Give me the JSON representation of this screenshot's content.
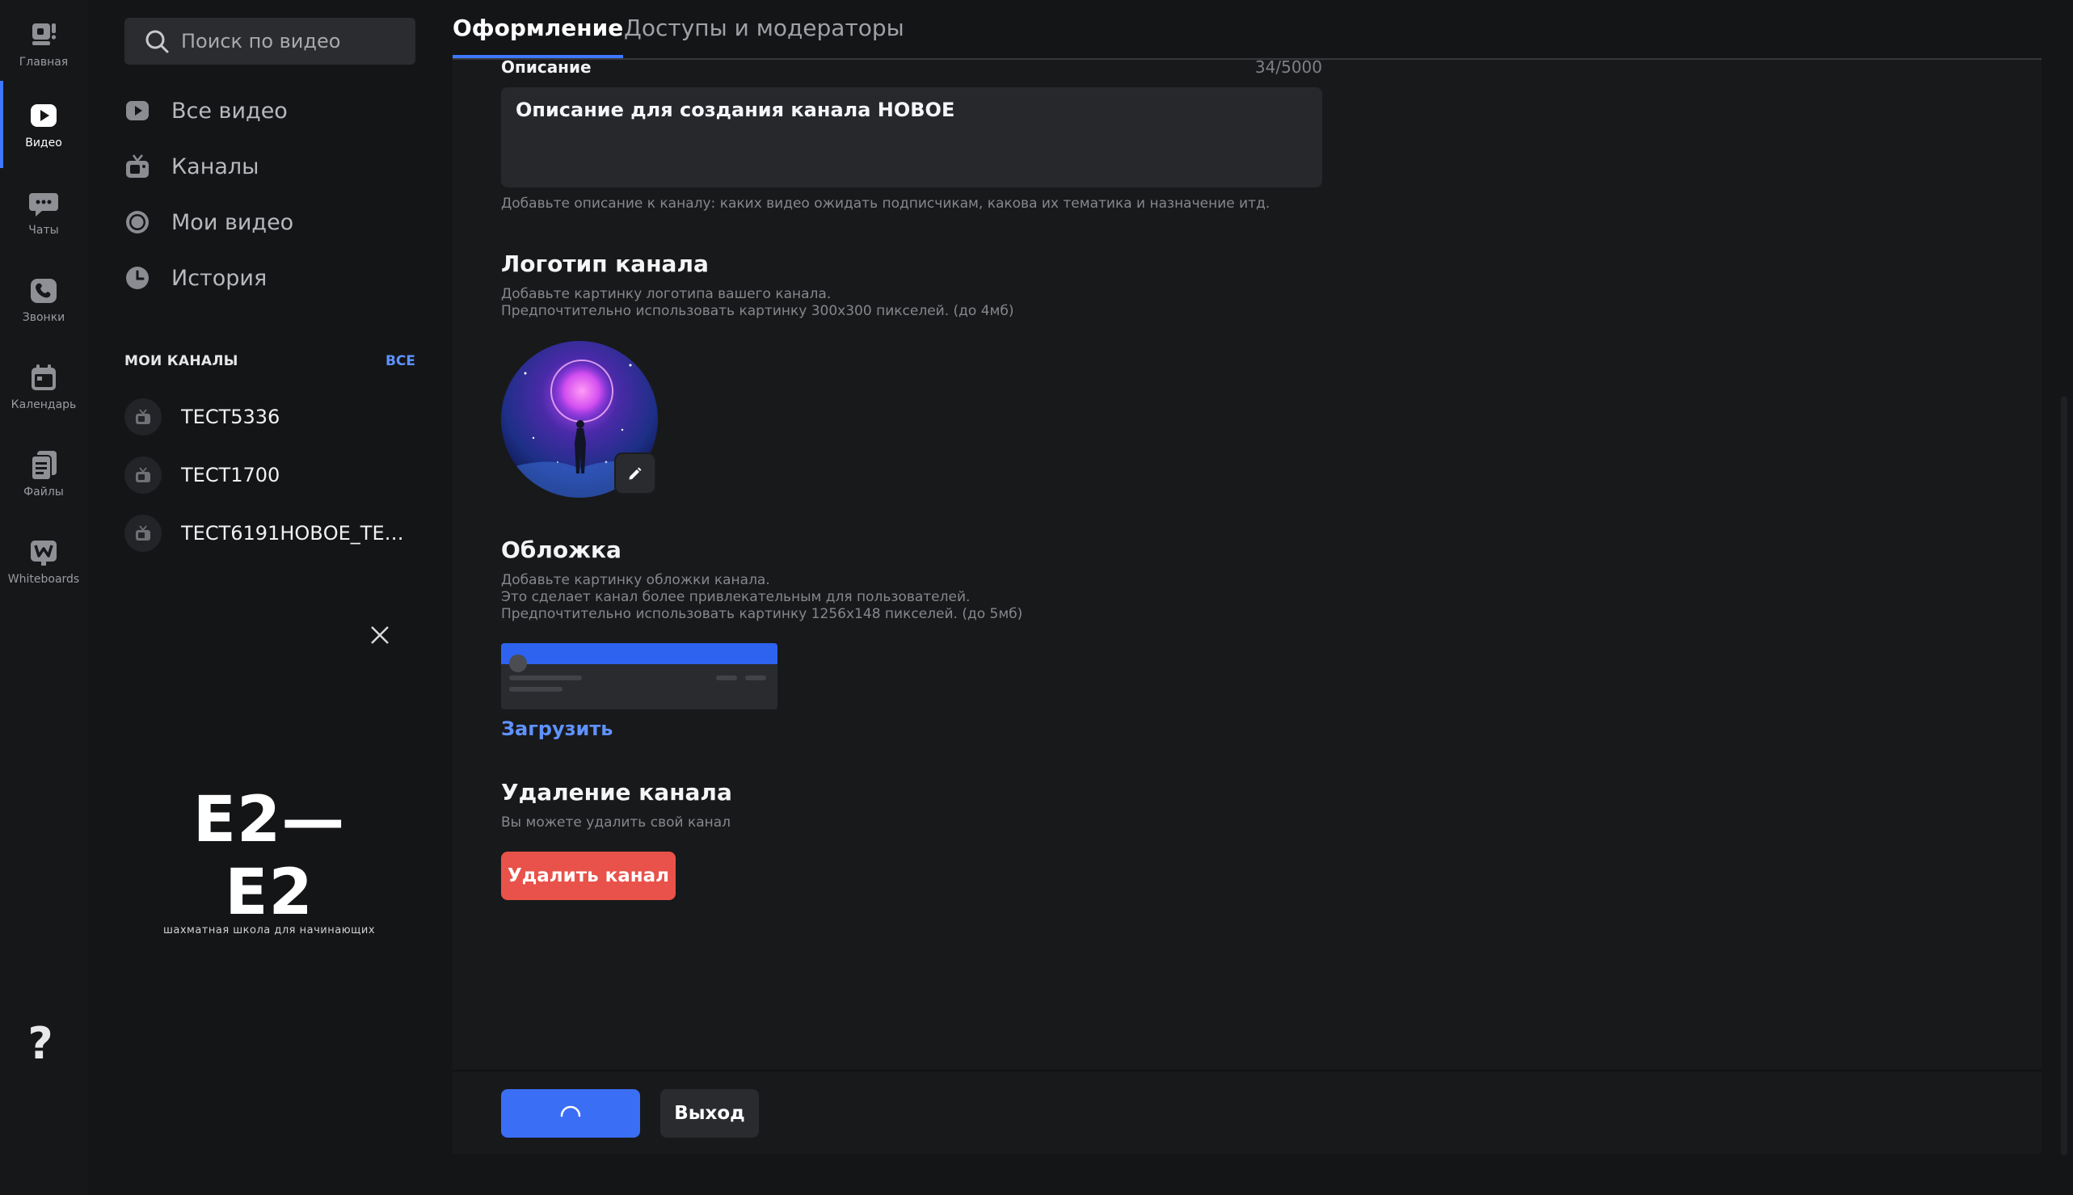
{
  "rail": {
    "items": [
      {
        "label": "Главная",
        "icon": "home-icon"
      },
      {
        "label": "Видео",
        "icon": "video-icon"
      },
      {
        "label": "Чаты",
        "icon": "chat-icon"
      },
      {
        "label": "Звонки",
        "icon": "phone-icon"
      },
      {
        "label": "Календарь",
        "icon": "calendar-icon"
      },
      {
        "label": "Файлы",
        "icon": "files-icon"
      },
      {
        "label": "Whiteboards",
        "icon": "whiteboard-icon"
      }
    ],
    "active": "Видео",
    "help": "?"
  },
  "sidebar": {
    "search_placeholder": "Поиск по видео",
    "nav": [
      {
        "label": "Все видео",
        "icon": "play-square-icon"
      },
      {
        "label": "Каналы",
        "icon": "tv-icon"
      },
      {
        "label": "Мои видео",
        "icon": "record-icon"
      },
      {
        "label": "История",
        "icon": "clock-icon"
      }
    ],
    "my_channels_title": "МОИ КАНАЛЫ",
    "all_link": "ВСЕ",
    "channels": [
      {
        "name": "ТЕСТ5336"
      },
      {
        "name": "ТЕСТ1700"
      },
      {
        "name": "ТЕСТ6191НОВОЕ_ТЕСТ6..."
      }
    ],
    "promo_logo": "E2—E2",
    "promo_sub": "шахматная школа для начинающих"
  },
  "tabs": [
    {
      "label": "Оформление",
      "active": true
    },
    {
      "label": "Доступы и модераторы",
      "active": false
    }
  ],
  "form": {
    "description_label": "Описание",
    "description_counter": "34/5000",
    "description_value": "Описание для создания канала НОВОЕ",
    "description_hint": "Добавьте описание к каналу: каких видео ожидать подписчикам, какова их тематика и назначение итд.",
    "logo_title": "Логотип канала",
    "logo_hint_1": "Добавьте картинку логотипа вашего канала.",
    "logo_hint_2": "Предпочтительно использовать картинку 300x300 пикселей. (до 4мб)",
    "cover_title": "Обложка",
    "cover_hint_1": "Добавьте картинку обложки канала.",
    "cover_hint_2": "Это сделает канал более привлекательным для пользователей.",
    "cover_hint_3": "Предпочтительно использовать картинку 1256x148 пикселей. (до 5мб)",
    "upload_label": "Загрузить",
    "delete_title": "Удаление канала",
    "delete_hint": "Вы можете удалить свой канал",
    "delete_button": "Удалить канал"
  },
  "footer": {
    "exit_button": "Выход",
    "save_state": "loading"
  },
  "colors": {
    "accent": "#3d78ff",
    "danger": "#e8524a",
    "link": "#5f92ff"
  }
}
